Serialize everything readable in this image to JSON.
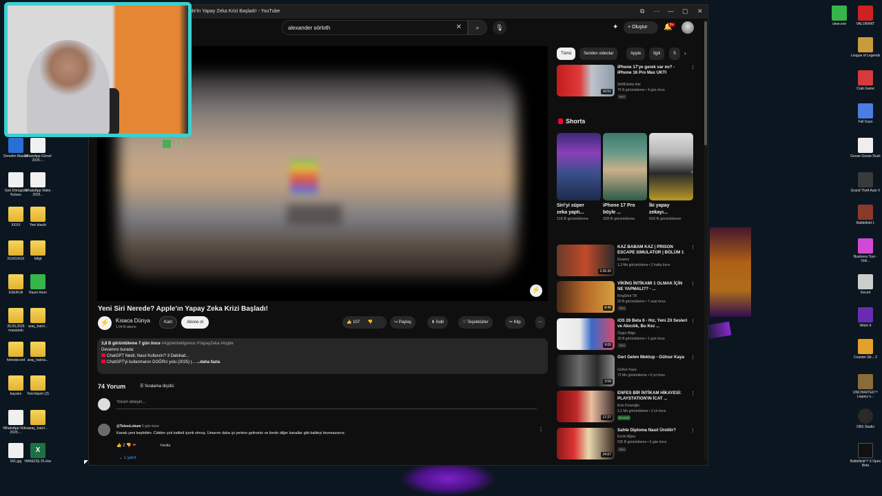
{
  "window": {
    "title": "ple'in Yapay Zeka Krizi Başladı! - YouTube",
    "controls": [
      "⧉",
      "⋯",
      "—",
      "▢",
      "✕"
    ]
  },
  "search": {
    "query": "alexander sörloth"
  },
  "topbar": {
    "create_label": "Oluştur",
    "notifications": "9+"
  },
  "video": {
    "title": "Yeni Siri Nerede? Apple'ın Yapay Zeka Krizi Başladı!",
    "channel": "Kısaca Dünya",
    "subscribers": "1,04 B abone",
    "join": "Katıl",
    "subscribe": "Abone ol",
    "likes": "107",
    "share": "Paylaş",
    "download": "İndir",
    "thanks": "Teşekkürler",
    "clip": "Klip"
  },
  "description": {
    "stats": "3,8 B görüntüleme  7 gün önce",
    "tags": "#AppleIntelligence #YapayZeka #Apple",
    "line1": "Devamını burada:",
    "link1": "ChatGPT Nedir, Nasıl Kullanılır? 3 Dakikad...",
    "link2": "ChatGPT'yi kullanmanın DOĞRU yolu (2025) |...",
    "more": "...daha fazla"
  },
  "comments": {
    "count": "74 Yorum",
    "sort": "Sıralama ölçütü:",
    "placeholder": "Yorum ekleyin...",
    "items": [
      {
        "author": "@TeknoLokum",
        "time": "5 gün önce",
        "text": "Kanalı yeni keşfettim. Cidden çok kaliteli içerik olmuş. Umarım daha iyi yerlere gelirsiniz ve ilerde diğer kanallar gibi kaliteyi bozmazsınız.",
        "likes": "2",
        "reply": "Yanıtla",
        "replies": "1 yanıt"
      }
    ]
  },
  "chips": [
    "Tümü",
    "Seriden videolar",
    "Apple",
    "İlgili",
    "S"
  ],
  "shorts": {
    "heading": "Shorts",
    "items": [
      {
        "title": "Siri'yi süper zeka yaptı...",
        "views": "116 B görüntüleme"
      },
      {
        "title": "iPhone 17 Pro böyle ...",
        "views": "328 B görüntüleme"
      },
      {
        "title": "İki yapay zekayı...",
        "views": "616 B görüntüleme"
      }
    ]
  },
  "recommendations": [
    {
      "title": "iPhone 17'ye gerek var mı? - iPhone 16 Pro Max UKTI",
      "channel": "ShiftDelete.Net",
      "meta": "75 B görüntüleme • 4 gün önce",
      "badge": "Yeni",
      "duration": "16:51"
    },
    {
      "title": "KAZ BABAM KAZ | PRISON ESCAPE SIMULATOR | BÖLÜM 1",
      "channel": "Elraenn",
      "meta": "1,3 Mn görüntüleme • 2 hafta önce",
      "badge": "",
      "duration": "2:26:30"
    },
    {
      "title": "VİKİNG İNTİKAMI 1 OLMAK İÇİN NE YAPMALI?? - ...",
      "channel": "KingShot TR",
      "meta": "20 B görüntüleme • 7 saat önce",
      "badge": "Yeni",
      "duration": "8:46"
    },
    {
      "title": "iOS 26 Beta 6 - Hız, Yeni Zil Sesleri ve Akıcılık, Bu Kez ...",
      "channel": "Özgür Bilge",
      "meta": "30 B görüntüleme • 1 gün önce",
      "badge": "Yeni",
      "duration": "9:00"
    },
    {
      "title": "Geri Gelen Mektup - Gülnur Kaya",
      "channel": "Gülnur Kaya",
      "meta": "72 Mn görüntüleme • 6 yıl önce",
      "badge": "",
      "duration": "3:59"
    },
    {
      "title": "ENFES BİR İNTİKAM HİKAYESİ: PLAYSTATION'IN İCAT ...",
      "channel": "Enis Kirazoğlu",
      "meta": "2,1 Mn görüntüleme • 2 yıl önce",
      "badge": "Dinmek",
      "duration": "17:27"
    },
    {
      "title": "Sahte Diploma Nasıl Üretilir?",
      "channel": "Evrim Ağacı",
      "meta": "535 B görüntüleme • 6 gün önce",
      "badge": "Yeni",
      "duration": "24:07"
    }
  ],
  "desktop_left": [
    {
      "label": "Denetim Masası"
    },
    {
      "label": "WhatsApp Görsel 2025-..."
    },
    {
      "label": "Geri Dönüşüm Kutusu"
    },
    {
      "label": "WhatsApp Video 2025..."
    },
    {
      "label": "XXXX"
    },
    {
      "label": "Yeni klasör"
    },
    {
      "label": "XGXGXGX"
    },
    {
      "label": "fdhjd"
    },
    {
      "label": "ESERUA"
    },
    {
      "label": "Razer Axon"
    },
    {
      "label": "26,05,2025 masaüstü"
    },
    {
      "label": "araç_hatırl..."
    },
    {
      "label": "hehedecord"
    },
    {
      "label": "araç_hatırla..."
    },
    {
      "label": "bayram"
    },
    {
      "label": "Yeni klasör (2)"
    },
    {
      "label": "WhatsApp Video 2025-..."
    },
    {
      "label": "araç_hatırl..."
    },
    {
      "label": "001.jpg"
    },
    {
      "label": "HAKEDİŞ 25.xlsx"
    }
  ],
  "desktop_right": [
    {
      "label": "clear.exe"
    },
    {
      "label": "VALORANT"
    },
    {
      "label": "League of Legends"
    },
    {
      "label": "Crab Game"
    },
    {
      "label": "Fall Guys"
    },
    {
      "label": "Goose Goose Duck"
    },
    {
      "label": "Grand Theft Auto V"
    },
    {
      "label": "Battlefield 1"
    },
    {
      "label": "Business Tour - Onli..."
    },
    {
      "label": "Deceit"
    },
    {
      "label": "Witch It"
    },
    {
      "label": "Counter-Str... 2"
    },
    {
      "label": "UNCHARTED™ Legacy o..."
    },
    {
      "label": "OBS Studio"
    },
    {
      "label": "Battlefield™ 6 Open Beta"
    }
  ],
  "overlay": {
    "level": "13"
  }
}
